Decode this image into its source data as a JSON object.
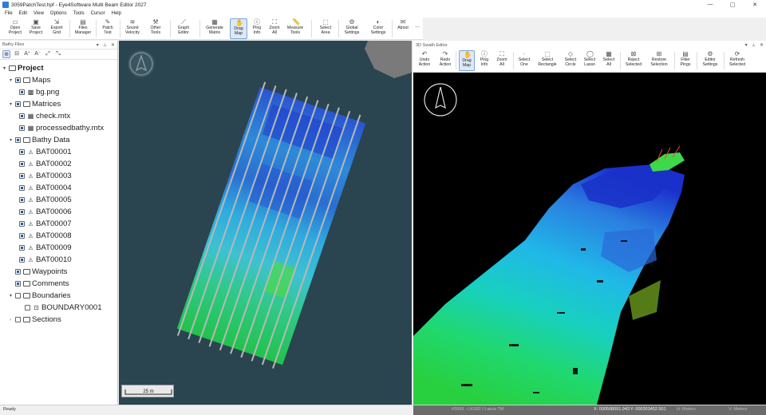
{
  "window": {
    "title": "3059PatchTest.hpf - Eye4Software Multi Beam Editor 2027"
  },
  "menu": [
    "File",
    "Edit",
    "View",
    "Options",
    "Tools",
    "Cursor",
    "Help"
  ],
  "ribbon": [
    {
      "label": "Open\nProject",
      "icon": "folder-icon"
    },
    {
      "label": "Save\nProject",
      "icon": "save-icon"
    },
    {
      "label": "Export\nGrid",
      "icon": "export-icon"
    },
    {
      "label": "Files\nManager",
      "icon": "files-icon"
    },
    {
      "label": "Patch\nTest",
      "icon": "patch-icon"
    },
    {
      "label": "Sound\nVelocity",
      "icon": "velocity-icon"
    },
    {
      "label": "Other\nTools",
      "icon": "tools-icon"
    },
    {
      "label": "Graph\nEditor",
      "icon": "graph-icon"
    },
    {
      "label": "Generate\nMatrix",
      "icon": "grid-icon"
    },
    {
      "label": "Drag\nMap",
      "icon": "hand-icon"
    },
    {
      "label": "Ping\nInfo",
      "icon": "info-icon"
    },
    {
      "label": "Zoom\nAll",
      "icon": "zoom-all-icon"
    },
    {
      "label": "Measure\nTools",
      "icon": "ruler-icon"
    },
    {
      "label": "Select\nArea",
      "icon": "select-icon"
    },
    {
      "label": "Global\nSettings",
      "icon": "settings-icon"
    },
    {
      "label": "Color\nSettings",
      "icon": "palette-icon"
    },
    {
      "label": "About",
      "icon": "about-icon"
    }
  ],
  "left_panel": {
    "title": "Bathy Files",
    "tree": [
      {
        "label": "Project"
      },
      {
        "label": "Maps"
      },
      {
        "label": "bg.png"
      },
      {
        "label": "Matrices"
      },
      {
        "label": "check.mtx"
      },
      {
        "label": "processedbathy.mtx"
      },
      {
        "label": "Bathy Data"
      },
      {
        "label": "BAT00001"
      },
      {
        "label": "BAT00002"
      },
      {
        "label": "BAT00003"
      },
      {
        "label": "BAT00004"
      },
      {
        "label": "BAT00005"
      },
      {
        "label": "BAT00006"
      },
      {
        "label": "BAT00007"
      },
      {
        "label": "BAT00008"
      },
      {
        "label": "BAT00009"
      },
      {
        "label": "BAT00010"
      },
      {
        "label": "Waypoints"
      },
      {
        "label": "Comments"
      },
      {
        "label": "Boundaries"
      },
      {
        "label": "BOUNDARY0001"
      },
      {
        "label": "Sections"
      }
    ]
  },
  "map": {
    "scale_label": "25 m"
  },
  "swath_editor": {
    "title": "3D Swath Editor",
    "toolbar": [
      {
        "label": "Undo\nAction",
        "icon": "undo-icon"
      },
      {
        "label": "Redo\nAction",
        "icon": "redo-icon"
      },
      {
        "label": "Drag\nMap",
        "icon": "hand-icon"
      },
      {
        "label": "Ping\nInfo",
        "icon": "info-icon"
      },
      {
        "label": "Zoom\nAll",
        "icon": "zoom-all-icon"
      },
      {
        "label": "Select\nOne",
        "icon": "dot-icon"
      },
      {
        "label": "Select\nRectangle",
        "icon": "rect-select-icon"
      },
      {
        "label": "Select\nCircle",
        "icon": "circle-select-icon"
      },
      {
        "label": "Select\nLasso",
        "icon": "lasso-icon"
      },
      {
        "label": "Select\nAll",
        "icon": "select-all-icon"
      },
      {
        "label": "Reject\nSelected",
        "icon": "reject-icon"
      },
      {
        "label": "Restore\nSelection",
        "icon": "restore-icon"
      },
      {
        "label": "Filter\nPings",
        "icon": "filter-icon"
      },
      {
        "label": "Editor\nSettings",
        "icon": "settings-icon"
      },
      {
        "label": "Refresh\nSelected",
        "icon": "refresh-icon"
      }
    ]
  },
  "status": {
    "left": "Ready",
    "epsg": "#3059 - LKS92 / Latvia TM",
    "x": "X: 000508091.943",
    "y": "Y: 000303452.501",
    "h_units": "H: Meters",
    "v_units": "V: Meters"
  },
  "colors": {
    "deep": "#1a3fd0",
    "mid": "#18b0e0",
    "shallow": "#2ee04a",
    "water": "#2a4550"
  }
}
